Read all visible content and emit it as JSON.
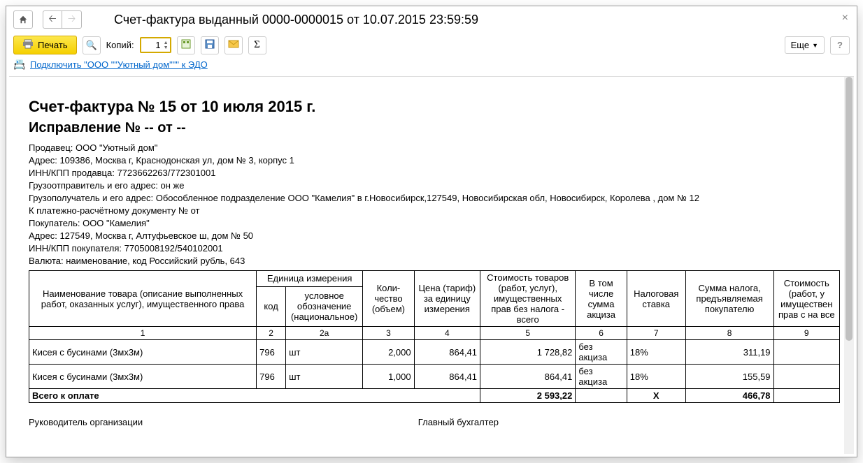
{
  "window": {
    "title": "Счет-фактура выданный 0000-0000015 от 10.07.2015 23:59:59"
  },
  "toolbar": {
    "print_label": "Печать",
    "copies_label": "Копий:",
    "copies_value": "1",
    "more_label": "Еще"
  },
  "edo": {
    "link_text": "Подключить \"ООО \"\"Уютный дом\"\"\" к ЭДО"
  },
  "doc": {
    "h1": "Счет-фактура № 15 от 10 июля 2015 г.",
    "h2": "Исправление № -- от --",
    "seller": "Продавец: ООО \"Уютный дом\"",
    "seller_address": "Адрес: 109386, Москва г, Краснодонская ул, дом № 3, корпус 1",
    "seller_inn": "ИНН/КПП продавца: 7723662263/772301001",
    "shipper": "Грузоотправитель и его адрес: он же",
    "consignee": "Грузополучатель и его адрес: Обособленное подразделение ООО \"Камелия\" в г.Новосибирск,127549, Новосибирская обл, Новосибирск, Королева , дом № 12",
    "payment_doc": "К платежно-расчётному документу №     от",
    "buyer": "Покупатель: ООО \"Камелия\"",
    "buyer_address": "Адрес: 127549, Москва г, Алтуфьевское ш, дом № 50",
    "buyer_inn": "ИНН/КПП покупателя: 7705008192/540102001",
    "currency": "Валюта: наименование, код Российский рубль, 643"
  },
  "table": {
    "headers": {
      "name": "Наименование товара (описание выполненных работ, оказанных услуг), имущественного права",
      "unit": "Единица измерения",
      "unit_code": "код",
      "unit_label": "условное обозначение (национальное)",
      "qty": "Коли-чество (объем)",
      "price": "Цена (тариф) за единицу измерения",
      "cost_net": "Стоимость товаров (работ, услуг), имущественных прав без налога - всего",
      "excise": "В том числе сумма акциза",
      "tax_rate": "Налоговая ставка",
      "tax_sum": "Сумма налога, предъявляемая покупателю",
      "cost_gross": "Стоимость (работ, у имуществен прав с на все"
    },
    "colnums": [
      "1",
      "2",
      "2а",
      "3",
      "4",
      "5",
      "6",
      "7",
      "8",
      "9"
    ],
    "rows": [
      {
        "name": "Кисея с бусинами (3мх3м)",
        "code": "796",
        "unit": "шт",
        "qty": "2,000",
        "price": "864,41",
        "net": "1 728,82",
        "excise": "без акциза",
        "rate": "18%",
        "tax": "311,19"
      },
      {
        "name": "Кисея с бусинами (3мх3м)",
        "code": "796",
        "unit": "шт",
        "qty": "1,000",
        "price": "864,41",
        "net": "864,41",
        "excise": "без акциза",
        "rate": "18%",
        "tax": "155,59"
      }
    ],
    "total_label": "Всего к оплате",
    "total_net": "2 593,22",
    "total_rate": "Х",
    "total_tax": "466,78"
  },
  "signatures": {
    "manager": "Руководитель организации",
    "accountant": "Главный бухгалтер"
  }
}
